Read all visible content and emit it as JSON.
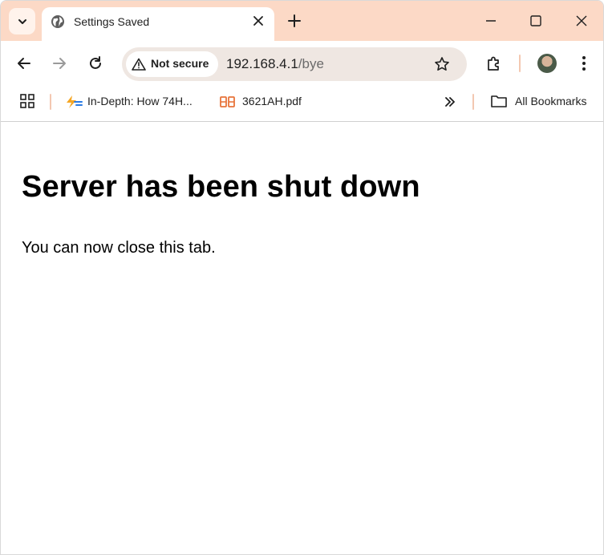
{
  "tabstrip": {
    "tab_title": "Settings Saved"
  },
  "toolbar": {
    "security_label": "Not secure",
    "url_host": "192.168.4.1",
    "url_path": "/bye"
  },
  "bookmarks": {
    "items": [
      {
        "label": "In-Depth: How 74H...",
        "icon": "lightning-favicon-icon"
      },
      {
        "label": "3621AH.pdf",
        "icon": "pdf-favicon-icon"
      }
    ],
    "all_bookmarks_label": "All Bookmarks"
  },
  "page": {
    "heading": "Server has been shut down",
    "message": "You can now close this tab."
  },
  "colors": {
    "tabstrip_bg": "#fcd9c6",
    "omnibox_bg": "#efe7e2",
    "accent_divider": "#f3c8b1"
  }
}
